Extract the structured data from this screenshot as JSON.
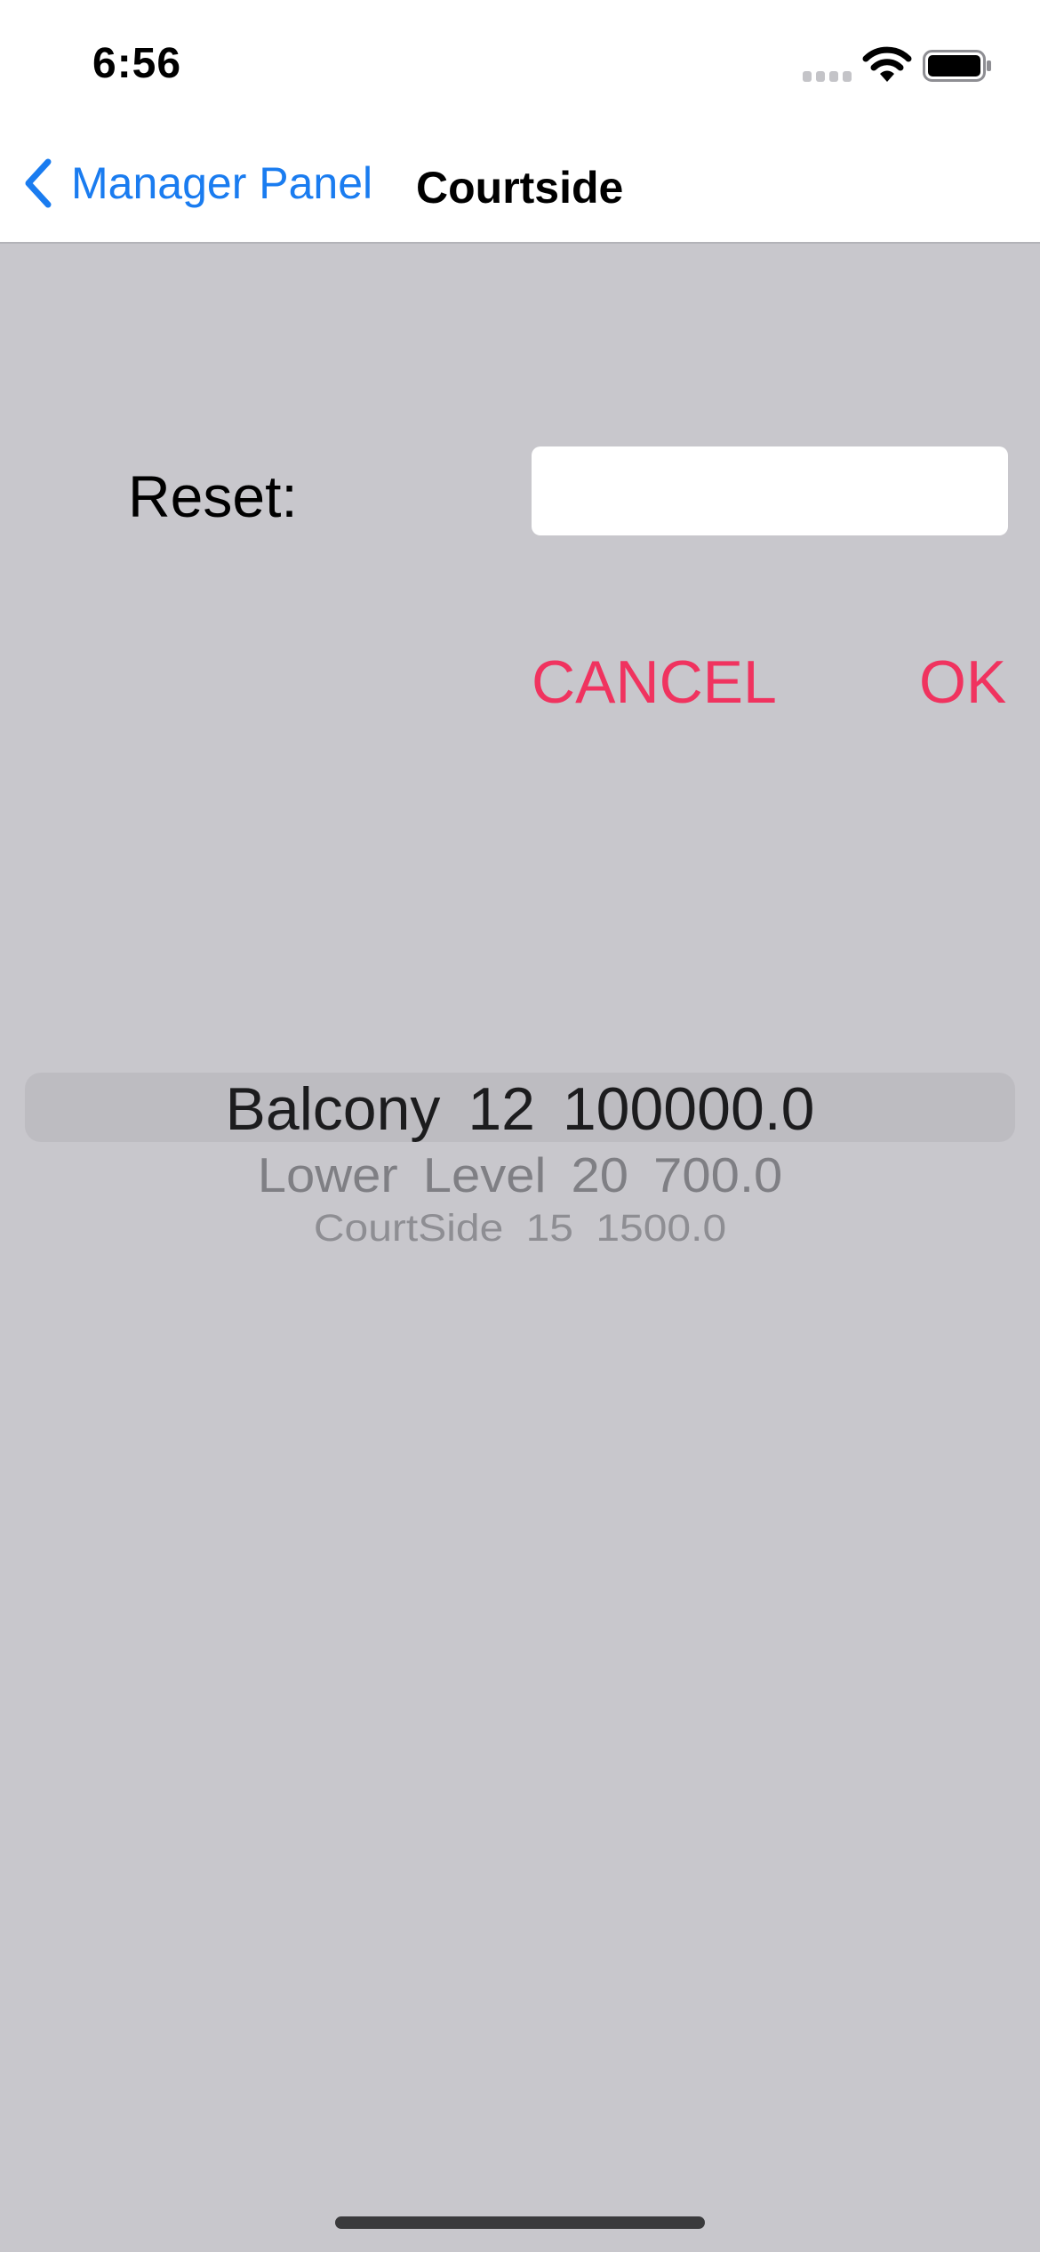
{
  "status_bar": {
    "time": "6:56",
    "icons": [
      "signal-icon",
      "wifi-icon",
      "battery-icon"
    ]
  },
  "nav": {
    "back_label": "Manager Panel",
    "title": "Courtside",
    "back_icon": "chevron-left-icon"
  },
  "form": {
    "reset_label": "Reset:",
    "reset_value": "",
    "cancel_label": "CANCEL",
    "ok_label": "OK"
  },
  "picker": {
    "rows": [
      "Balcony  12  100000.0",
      "Lower Level  20  700.0",
      "CourtSide  15  1500.0"
    ],
    "selected_index": 0
  },
  "colors": {
    "background": "#c8c7cc",
    "accent_blue": "#1a7cf0",
    "action_red": "#f0335f"
  }
}
